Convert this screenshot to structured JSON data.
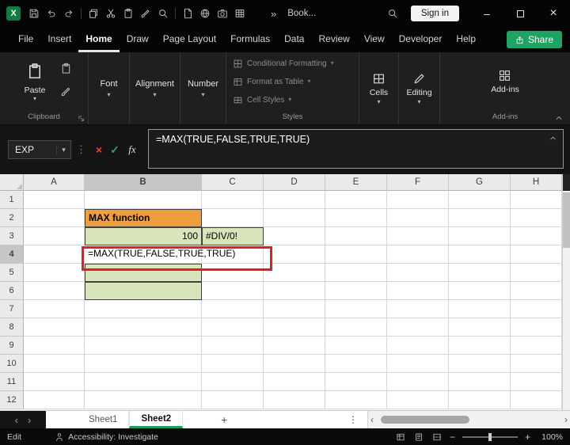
{
  "titlebar": {
    "icons": [
      "save",
      "undo",
      "redo",
      "divider",
      "copy",
      "cut",
      "clipboard",
      "format-painter",
      "zoom",
      "divider",
      "document",
      "link",
      "camera",
      "table"
    ],
    "overflow": "»",
    "title": "Book...",
    "sign_in_label": "Sign in"
  },
  "menubar": {
    "items": [
      "File",
      "Insert",
      "Home",
      "Draw",
      "Page Layout",
      "Formulas",
      "Data",
      "Review",
      "View",
      "Developer",
      "Help"
    ],
    "active": "Home",
    "share_label": "Share"
  },
  "ribbon": {
    "paste_label": "Paste",
    "collapsed_groups": [
      "Font",
      "Alignment",
      "Number"
    ],
    "styles_items": [
      "Conditional Formatting",
      "Format as Table",
      "Cell Styles"
    ],
    "cells_label": "Cells",
    "editing_label": "Editing",
    "addins_label": "Add-ins",
    "groups": {
      "clipboard": "Clipboard",
      "styles": "Styles",
      "addins": "Add-ins"
    }
  },
  "formula_bar": {
    "name_box_value": "EXP",
    "fx_label": "fx",
    "formula": "=MAX(TRUE,FALSE,TRUE,TRUE)"
  },
  "grid": {
    "columns": [
      "A",
      "B",
      "C",
      "D",
      "E",
      "F",
      "G",
      "H"
    ],
    "row_count": 12,
    "selected_column": "B",
    "selected_row": 4,
    "cells": [
      {
        "ref": "B2",
        "text": "MAX function",
        "fill": "orange",
        "bold": true,
        "align": "left",
        "border": true
      },
      {
        "ref": "B3",
        "text": "100",
        "fill": "green",
        "align": "right",
        "border": true
      },
      {
        "ref": "C3",
        "text": "#DIV/0!",
        "fill": "green",
        "align": "left",
        "border": true
      },
      {
        "ref": "B4",
        "text": "=MAX(TRUE,FALSE,TRUE,TRUE)",
        "fill": "white",
        "align": "left",
        "overflow": true,
        "annotated": true
      },
      {
        "ref": "B5",
        "text": "",
        "fill": "green",
        "border": true
      },
      {
        "ref": "B6",
        "text": "",
        "fill": "green",
        "border": true
      }
    ]
  },
  "sheet_tabs": {
    "tabs": [
      {
        "label": "Sheet1",
        "active": false
      },
      {
        "label": "Sheet2",
        "active": true
      }
    ],
    "add_label": "+"
  },
  "status_bar": {
    "mode": "Edit",
    "accessibility": "Accessibility: Investigate",
    "zoom_percent": "100%"
  },
  "colors": {
    "accent_green": "#21A366",
    "orange_fill": "#EF9E3F",
    "green_fill": "#D7E4BC",
    "annotation_red": "#E02020"
  }
}
